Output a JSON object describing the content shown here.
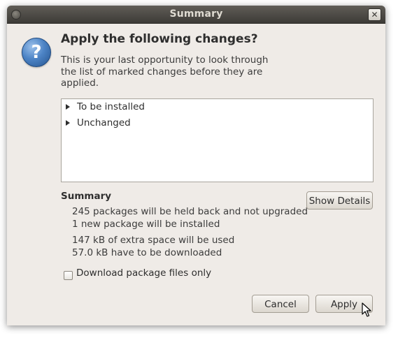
{
  "window": {
    "title": "Summary",
    "close_glyph": "✕"
  },
  "dialog": {
    "icon_glyph": "?",
    "heading": "Apply the following changes?",
    "description": "This is your last opportunity to look through the list of marked changes before they are applied."
  },
  "tree": {
    "items": [
      {
        "label": "To be installed",
        "expanded": false
      },
      {
        "label": "Unchanged",
        "expanded": false
      }
    ]
  },
  "summary": {
    "title": "Summary",
    "lines": [
      "245 packages will be held back and not upgraded",
      "1 new package will be installed",
      "147 kB of extra space will be used",
      "57.0 kB have to be downloaded"
    ],
    "show_details_label": "Show Details"
  },
  "options": {
    "download_only_label": "Download package files only",
    "download_only_checked": false
  },
  "buttons": {
    "cancel_label": "Cancel",
    "apply_label": "Apply"
  }
}
